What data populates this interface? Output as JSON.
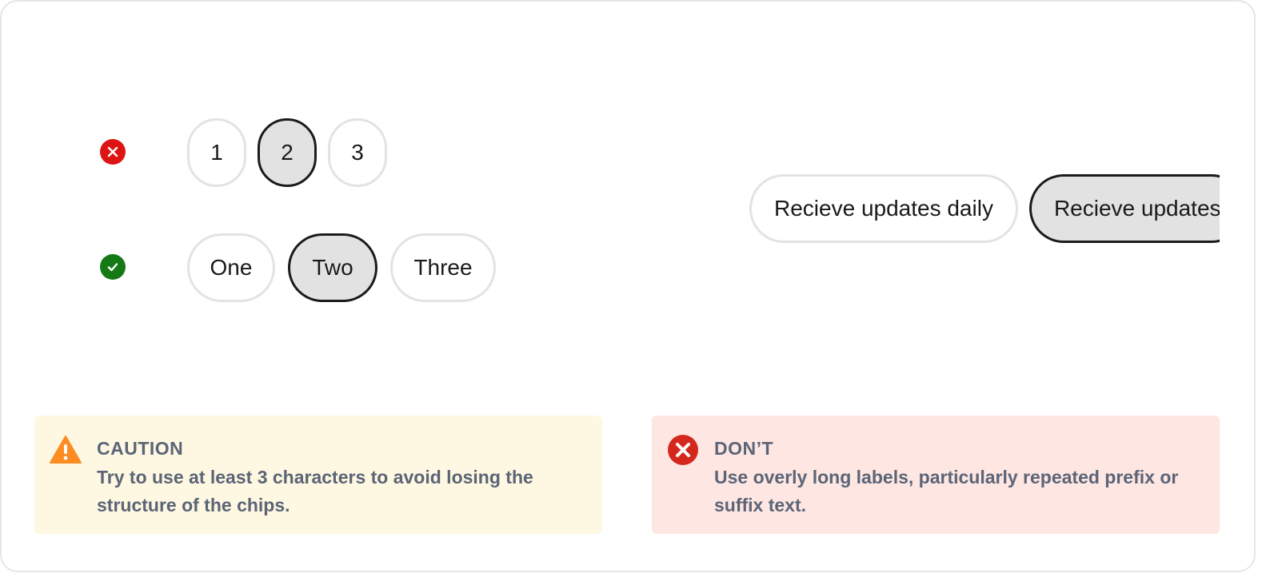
{
  "examples": {
    "bad": {
      "icon": "error-circle-icon",
      "color": "#dd1414",
      "chips": [
        {
          "label": "1",
          "selected": false
        },
        {
          "label": "2",
          "selected": true
        },
        {
          "label": "3",
          "selected": false
        }
      ]
    },
    "good": {
      "icon": "check-circle-icon",
      "color": "#157a16",
      "chips": [
        {
          "label": "One",
          "selected": false
        },
        {
          "label": "Two",
          "selected": true
        },
        {
          "label": "Three",
          "selected": false
        }
      ]
    },
    "long": {
      "chips": [
        {
          "label": "Recieve updates daily",
          "selected": false
        },
        {
          "label": "Recieve updates",
          "selected": true
        }
      ]
    }
  },
  "notes": {
    "caution": {
      "icon": "warning-triangle-icon",
      "color": "#fd8c22",
      "background": "#fef7e1",
      "title": "CAUTION",
      "body": "Try to use at least 3 characters to avoid losing the structure of the chips."
    },
    "dont": {
      "icon": "error-circle-icon",
      "color": "#d4281e",
      "background": "#fee6e2",
      "title": "DON’T",
      "body": "Use overly long labels, particularly repeated prefix or suffix text."
    }
  }
}
